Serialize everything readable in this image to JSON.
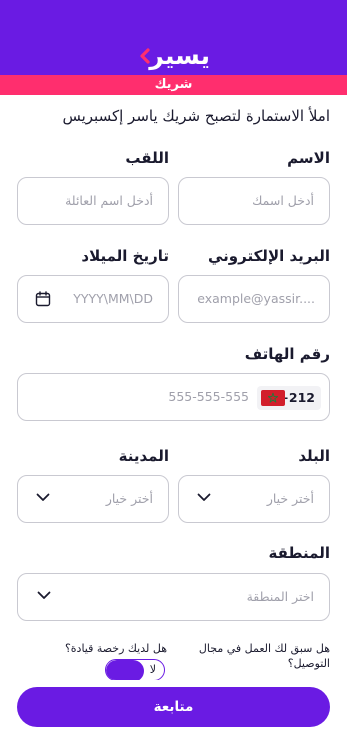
{
  "brand": {
    "logo_text": "يسير",
    "accent": "#6a1be3",
    "pink": "#ff2e6e"
  },
  "header": {
    "partner_label": "شريك"
  },
  "intro": "املأ الاستمارة لتصبح شريك ياسر إكسبريس",
  "fields": {
    "first_name": {
      "label": "الاسم",
      "placeholder": "أدخل اسمك"
    },
    "last_name": {
      "label": "اللقب",
      "placeholder": "أدخل اسم العائلة"
    },
    "email": {
      "label": "البريد الإلكتروني",
      "placeholder": "example@yassir...."
    },
    "birth_date": {
      "label": "تاريخ الميلاد",
      "placeholder": "YYYY\\MM\\DD",
      "icon": "calendar-icon"
    },
    "phone": {
      "label": "رقم الهاتف",
      "placeholder": "555-555-555",
      "country_code": "+212",
      "flag": "morocco-flag-icon"
    },
    "country": {
      "label": "البلد",
      "placeholder": "أختر خيار"
    },
    "city": {
      "label": "المدينة",
      "placeholder": "أختر خيار"
    },
    "region": {
      "label": "المنطقة",
      "placeholder": "اختر المنطقة"
    }
  },
  "questions": {
    "delivery_experience": "هل سبق لك العمل في مجال التوصيل؟",
    "driving_license": "هل لديك رخصة قيادة؟",
    "license_toggle_label": "لا"
  },
  "cta": {
    "label": "متابعة"
  }
}
